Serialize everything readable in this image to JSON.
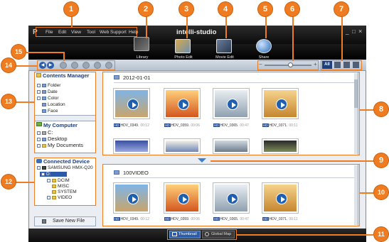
{
  "menu": {
    "items": [
      "File",
      "Edit",
      "View",
      "Tool",
      "Web Support",
      "Help"
    ]
  },
  "app": {
    "title": "intelli-studio"
  },
  "window": {
    "min": "_",
    "max": "□",
    "close": "×"
  },
  "modes": [
    {
      "label": "Library"
    },
    {
      "label": "Photo Edit"
    },
    {
      "label": "Movie Edit"
    },
    {
      "label": "Share"
    }
  ],
  "filter": {
    "all": "All"
  },
  "contents_manager": {
    "title": "Contents Manager",
    "items": [
      "Folder",
      "Date",
      "Color",
      "Location",
      "Face"
    ]
  },
  "my_computer": {
    "title": "My Computer",
    "items": [
      "C:",
      "Desktop",
      "My Documents"
    ]
  },
  "connected_device": {
    "title": "Connected Device",
    "device": "SAMSUNG HMX-Q20",
    "drive": "D:",
    "folders": [
      "DCIM",
      "MISC",
      "SYSTEM",
      "VIDEO"
    ]
  },
  "save_new_file": "Save New File",
  "top_group": {
    "header": "2012-01-01"
  },
  "bottom_group": {
    "header": "100VIDEO"
  },
  "videos": [
    {
      "name": "HDV_0349.",
      "dur": "00:12",
      "badge": "HD"
    },
    {
      "name": "HDV_0359.",
      "dur": "00:06",
      "badge": "HD"
    },
    {
      "name": "HDV_0365.",
      "dur": "00:47",
      "badge": "HD"
    },
    {
      "name": "HDV_0371.",
      "dur": "00:11",
      "badge": "HD"
    }
  ],
  "view_tabs": {
    "thumbnail": "Thumbnail",
    "global_map": "Global Map"
  },
  "callouts": [
    "1",
    "2",
    "3",
    "4",
    "5",
    "6",
    "7",
    "8",
    "9",
    "10",
    "11",
    "12",
    "13",
    "14",
    "15"
  ],
  "colors": {
    "accent": "#ef7c20",
    "dark_bar": "#111111",
    "panel_head": "#1d3d78"
  }
}
